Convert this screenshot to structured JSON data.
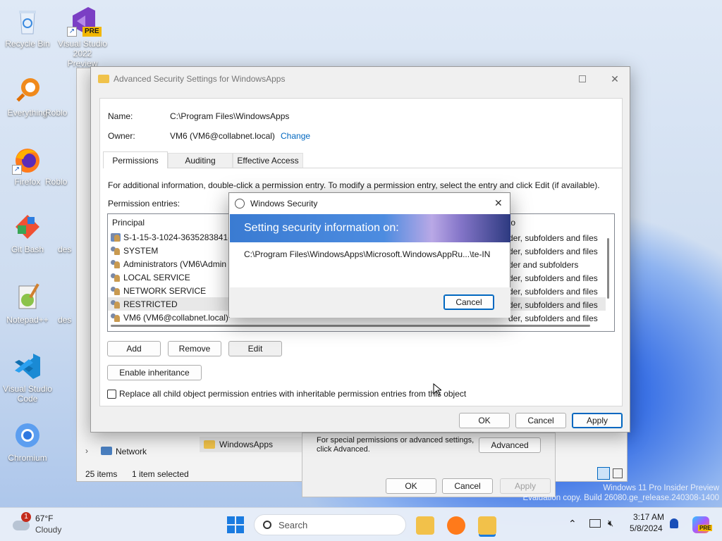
{
  "desktop": {
    "icons": [
      {
        "label": "Recycle Bin",
        "icon": "recycle-bin-icon"
      },
      {
        "label": "Visual Studio 2022 Preview",
        "badge": "PRE",
        "icon": "visual-studio-preview-icon"
      },
      {
        "label": "Everything",
        "icon": "everything-search-icon"
      },
      {
        "label": "Roblo",
        "icon": "roblox-icon"
      },
      {
        "label": "Firefox",
        "icon": "firefox-icon"
      },
      {
        "label": "Roblo",
        "icon": "roblox-icon"
      },
      {
        "label": "Git Bash",
        "icon": "git-bash-icon"
      },
      {
        "label": "des",
        "icon": "desktop-file-icon"
      },
      {
        "label": "Notepad++",
        "icon": "notepad-plus-plus-icon"
      },
      {
        "label": "des",
        "icon": "desktop-file-icon"
      },
      {
        "label": "Visual Studio Code",
        "icon": "vscode-icon"
      },
      {
        "label": "Chromium",
        "icon": "chromium-icon"
      }
    ],
    "watermark_line1": "Windows 11 Pro Insider Preview",
    "watermark_line2": "Evaluation copy. Build 26080.ge_release.240308-1400"
  },
  "explorer": {
    "nav_network": "Network",
    "folder_item": "WindowsApps",
    "status_items": "25 items",
    "status_selected": "1 item selected"
  },
  "advanced_security": {
    "title": "Advanced Security Settings for WindowsApps",
    "name_label": "Name:",
    "name_value": "C:\\Program Files\\WindowsApps",
    "owner_label": "Owner:",
    "owner_value": "VM6 (VM6@collabnet.local)",
    "change_link": "Change",
    "tabs": [
      "Permissions",
      "Auditing",
      "Effective Access"
    ],
    "info_text": "For additional information, double-click a permission entry. To modify a permission entry, select the entry and click Edit (if available).",
    "entries_label": "Permission entries:",
    "columns": {
      "principal": "Principal",
      "applies_to": "to"
    },
    "entries": [
      {
        "principal": "S-1-15-3-1024-3635283841-2",
        "applies_to": "der, subfolders and files"
      },
      {
        "principal": "SYSTEM",
        "applies_to": "der, subfolders and files"
      },
      {
        "principal": "Administrators (VM6\\Admin",
        "applies_to": "der and subfolders"
      },
      {
        "principal": "LOCAL SERVICE",
        "applies_to": "der, subfolders and files"
      },
      {
        "principal": "NETWORK SERVICE",
        "applies_to": "der, subfolders and files"
      },
      {
        "principal": "RESTRICTED",
        "applies_to": "der, subfolders and files"
      },
      {
        "principal": "VM6 (VM6@collabnet.local)",
        "applies_to": "der, subfolders and files"
      }
    ],
    "add_button": "Add",
    "remove_button": "Remove",
    "edit_button": "Edit",
    "enable_inheritance_button": "Enable inheritance",
    "replace_checkbox_label": "Replace all child object permission entries with inheritable permission entries from this object",
    "replace_checked": false,
    "ok_button": "OK",
    "cancel_button": "Cancel",
    "apply_button": "Apply"
  },
  "windows_security": {
    "title": "Windows Security",
    "heading": "Setting security information on:",
    "path": "C:\\Program Files\\WindowsApps\\Microsoft.WindowsAppRu...\\te-IN",
    "cancel_button": "Cancel"
  },
  "properties": {
    "advanced_text": "For special permissions or advanced settings, click Advanced.",
    "advanced_button": "Advanced",
    "ok_button": "OK",
    "cancel_button": "Cancel",
    "apply_button": "Apply"
  },
  "taskbar": {
    "weather_temp": "67°F",
    "weather_desc": "Cloudy",
    "weather_badge": "1",
    "search_placeholder": "Search",
    "time": "3:17 AM",
    "date": "5/8/2024",
    "copilot_badge": "PRE"
  },
  "colors": {
    "accent": "#0067c0",
    "link": "#0067c0"
  }
}
